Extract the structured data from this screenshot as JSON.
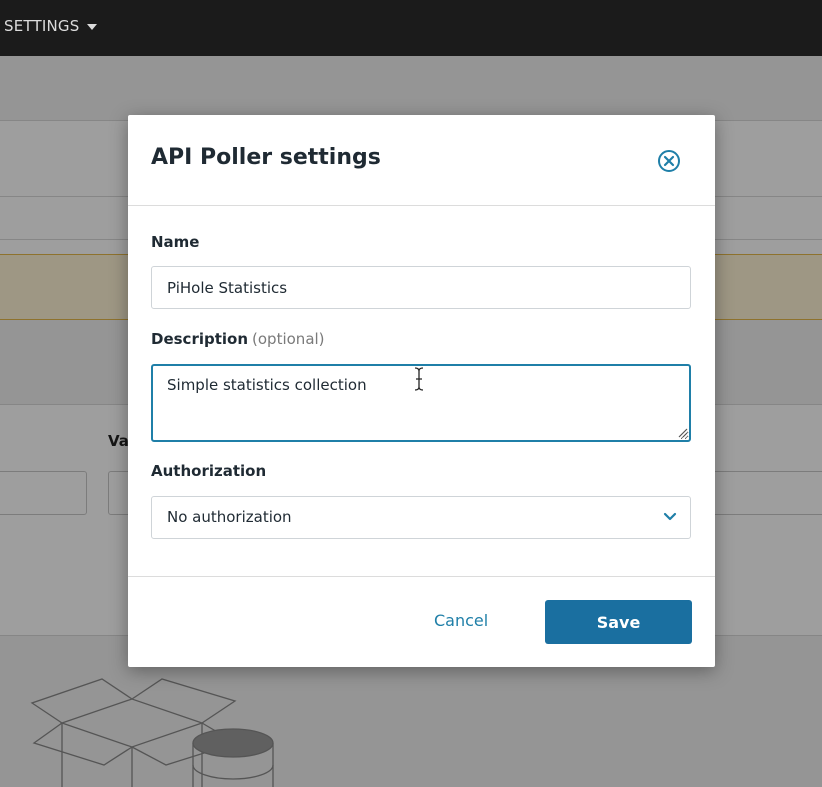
{
  "topbar": {
    "nav_settings_label": "SETTINGS"
  },
  "background": {
    "partial_label": "Va"
  },
  "modal": {
    "title": "API Poller settings",
    "fields": {
      "name": {
        "label": "Name",
        "value": "PiHole Statistics"
      },
      "description": {
        "label": "Description",
        "optional_hint": "(optional)",
        "value": "Simple statistics collection"
      },
      "authorization": {
        "label": "Authorization",
        "selected": "No authorization"
      }
    },
    "footer": {
      "cancel_label": "Cancel",
      "save_label": "Save"
    }
  },
  "colors": {
    "accent": "#1a6fa0",
    "link": "#1f7fa8",
    "topbar": "#1b1b1b",
    "warning_border": "#e6b84a"
  },
  "icons": [
    "caret-down-icon",
    "close-circle-icon",
    "chevron-down-icon",
    "text-cursor-icon",
    "resize-grip-icon",
    "box-illustration"
  ]
}
